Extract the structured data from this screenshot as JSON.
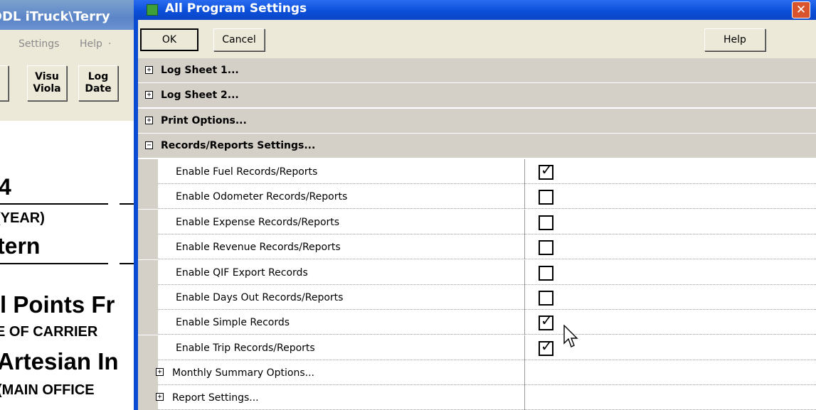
{
  "background_app": {
    "title": "DDL iTruck\\Terry",
    "menu": [
      "Settings",
      "Help"
    ],
    "toolbar": [
      {
        "label_top": "Visu",
        "label_bottom": "Viola"
      },
      {
        "label_top": "Log",
        "label_bottom": "Date"
      }
    ],
    "texts": [
      "4",
      "(YEAR)",
      "tern",
      ")",
      "l Points Fr",
      "E OF CARRIER",
      "Artesian In",
      "(MAIN OFFICE"
    ]
  },
  "dialog": {
    "title": "All Program Settings",
    "close_glyph": "✕",
    "buttons": {
      "ok": "OK",
      "cancel": "Cancel",
      "help": "Help"
    },
    "sections": [
      {
        "label": "Log Sheet 1...",
        "expander": "+"
      },
      {
        "label": "Log Sheet 2...",
        "expander": "+"
      },
      {
        "label": "Print Options...",
        "expander": "+"
      },
      {
        "label": "Records/Reports Settings...",
        "expander": "−"
      }
    ],
    "settings": [
      {
        "label": "Enable Fuel Records/Reports",
        "checked": true
      },
      {
        "label": "Enable Odometer Records/Reports",
        "checked": false
      },
      {
        "label": "Enable Expense Records/Reports",
        "checked": false
      },
      {
        "label": "Enable Revenue Records/Reports",
        "checked": false
      },
      {
        "label": "Enable QIF Export Records",
        "checked": false
      },
      {
        "label": "Enable Days Out Records/Reports",
        "checked": false
      },
      {
        "label": "Enable Simple Records",
        "checked": true
      },
      {
        "label": "Enable Trip Records/Reports",
        "checked": true
      }
    ],
    "subsections": [
      {
        "label": "Monthly Summary Options...",
        "expander": "+"
      },
      {
        "label": "Report Settings...",
        "expander": "+"
      }
    ],
    "check_glyph": "✓"
  }
}
